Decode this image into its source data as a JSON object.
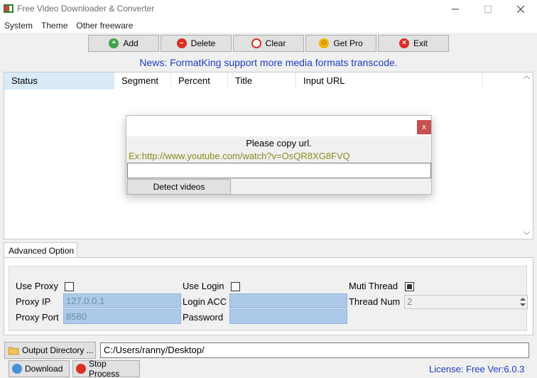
{
  "window": {
    "title": "Free Video Downloader & Converter"
  },
  "menu": {
    "items": [
      "System",
      "Theme",
      "Other freeware"
    ]
  },
  "toolbar": {
    "add": "Add",
    "delete": "Delete",
    "clear": "Clear",
    "get_pro": "Get Pro",
    "exit": "Exit"
  },
  "news": "News: FormatKing support more media formats transcode.",
  "list": {
    "columns": [
      "Status",
      "Segment",
      "Percent",
      "Title",
      "Input URL"
    ]
  },
  "dialog": {
    "message": "Please copy url.",
    "example": "Ex:http://www.youtube.com/watch?v=OsQR8XG8FVQ",
    "input_value": "",
    "close_label": "x",
    "detect_button": "Detect videos"
  },
  "advanced": {
    "tab_label": "Advanced Option",
    "use_proxy": "Use Proxy",
    "proxy_ip_label": "Proxy IP",
    "proxy_ip": "127.0.0.1",
    "proxy_port_label": "Proxy Port",
    "proxy_port": "8580",
    "use_login": "Use Login",
    "login_acc_label": "Login ACC",
    "login_acc": "",
    "password_label": "Password",
    "password": "",
    "muti_thread": "Muti Thread",
    "muti_thread_checked": true,
    "thread_num_label": "Thread Num",
    "thread_num": "2"
  },
  "bottom": {
    "output_dir_button": "Output Directory ...",
    "output_dir": "C:/Users/ranny/Desktop/",
    "download": "Download",
    "stop": "Stop Process",
    "license": "License: Free Ver:6.0.3"
  },
  "colors": {
    "news": "#1f3cc6",
    "example": "#8a8a1e",
    "field": "#adc9e9",
    "close": "#c75050"
  }
}
